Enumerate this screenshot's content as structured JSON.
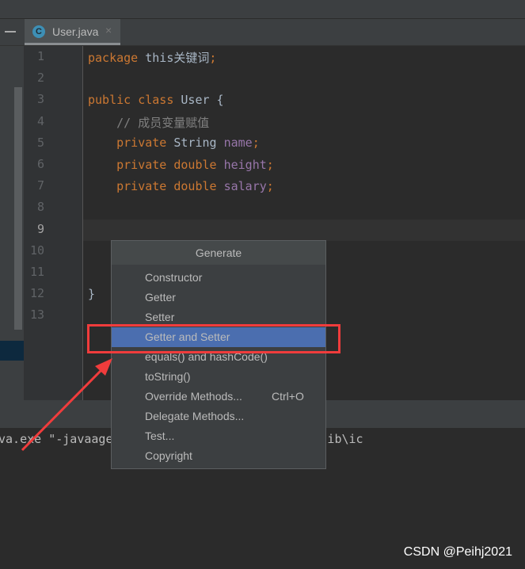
{
  "tab": {
    "icon": "java-class-icon",
    "icon_letter": "C",
    "label": "User.java",
    "close": "×"
  },
  "code_lines": [
    {
      "n": "1"
    },
    {
      "n": "2"
    },
    {
      "n": "3"
    },
    {
      "n": "4"
    },
    {
      "n": "5"
    },
    {
      "n": "6"
    },
    {
      "n": "7"
    },
    {
      "n": "8"
    },
    {
      "n": "9"
    },
    {
      "n": "10"
    },
    {
      "n": "11"
    },
    {
      "n": "12"
    },
    {
      "n": "13"
    }
  ],
  "code": {
    "l1_kw": "package",
    "l1_rest": " this关键词",
    "l1_semi": ";",
    "l3_kw": "public class",
    "l3_rest": " User {",
    "l4": "    // 成员变量赋值",
    "l5_kw": "    private",
    "l5_type": " String ",
    "l5_f": "name",
    "l5_s": ";",
    "l6_kw": "    private double ",
    "l6_f": "height",
    "l6_s": ";",
    "l7_kw": "    private double ",
    "l7_f": "salary",
    "l7_s": ";",
    "l12": "}"
  },
  "console": {
    "text": "va.exe \"-javaagent:D:\\IntelliJ IDEA 2021.1.1\\lib\\ic"
  },
  "menu": {
    "title": "Generate",
    "items": [
      {
        "label": "Constructor"
      },
      {
        "label": "Getter"
      },
      {
        "label": "Setter"
      },
      {
        "label": "Getter and Setter",
        "selected": true
      },
      {
        "label": "equals() and hashCode()"
      },
      {
        "label": "toString()"
      },
      {
        "label": "Override Methods...",
        "shortcut": "Ctrl+O"
      },
      {
        "label": "Delegate Methods..."
      },
      {
        "label": "Test..."
      },
      {
        "label": "Copyright"
      }
    ]
  },
  "annotation": {
    "color": "#f03c3c"
  },
  "watermark": "CSDN @Peihj2021"
}
